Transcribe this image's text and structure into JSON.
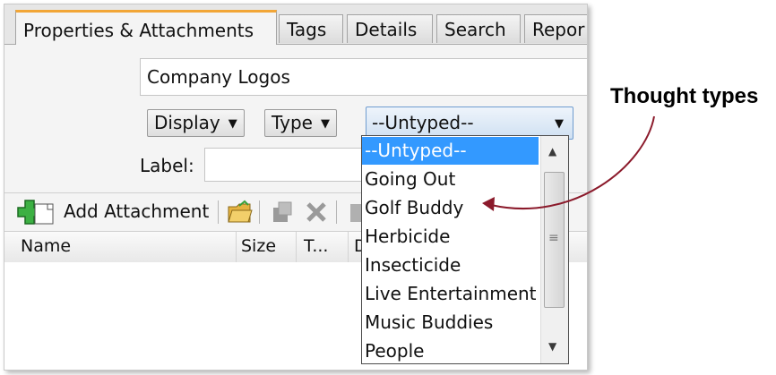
{
  "tabs": [
    {
      "label": "Properties & Attachments",
      "active": true
    },
    {
      "label": "Tags",
      "active": false
    },
    {
      "label": "Details",
      "active": false
    },
    {
      "label": "Search",
      "active": false
    },
    {
      "label": "Repor",
      "active": false
    }
  ],
  "name_field": {
    "value": "Company Logos"
  },
  "controls": {
    "display_label": "Display",
    "type_label": "Type",
    "type_select_value": "--Untyped--",
    "label_field_label": "Label:",
    "label_field_value": ""
  },
  "toolbar": {
    "add_attachment_label": "Add Attachment",
    "icons": [
      "add-attachment-icon",
      "folder-icon",
      "link-icon",
      "delete-icon",
      "copy-icon"
    ]
  },
  "columns": [
    "Name",
    "Size",
    "T...",
    "D"
  ],
  "dropdown": {
    "selected_index": 0,
    "options": [
      "--Untyped--",
      "Going Out",
      "Golf Buddy",
      "Herbicide",
      "Insecticide",
      "Live Entertainment",
      "Music Buddies",
      "People"
    ]
  },
  "annotation": {
    "text": "Thought types",
    "color": "#8b1a2b"
  },
  "colors": {
    "active_tab_accent": "#f2a637",
    "selection": "#3399ff",
    "select_border": "#6f9ccf"
  }
}
